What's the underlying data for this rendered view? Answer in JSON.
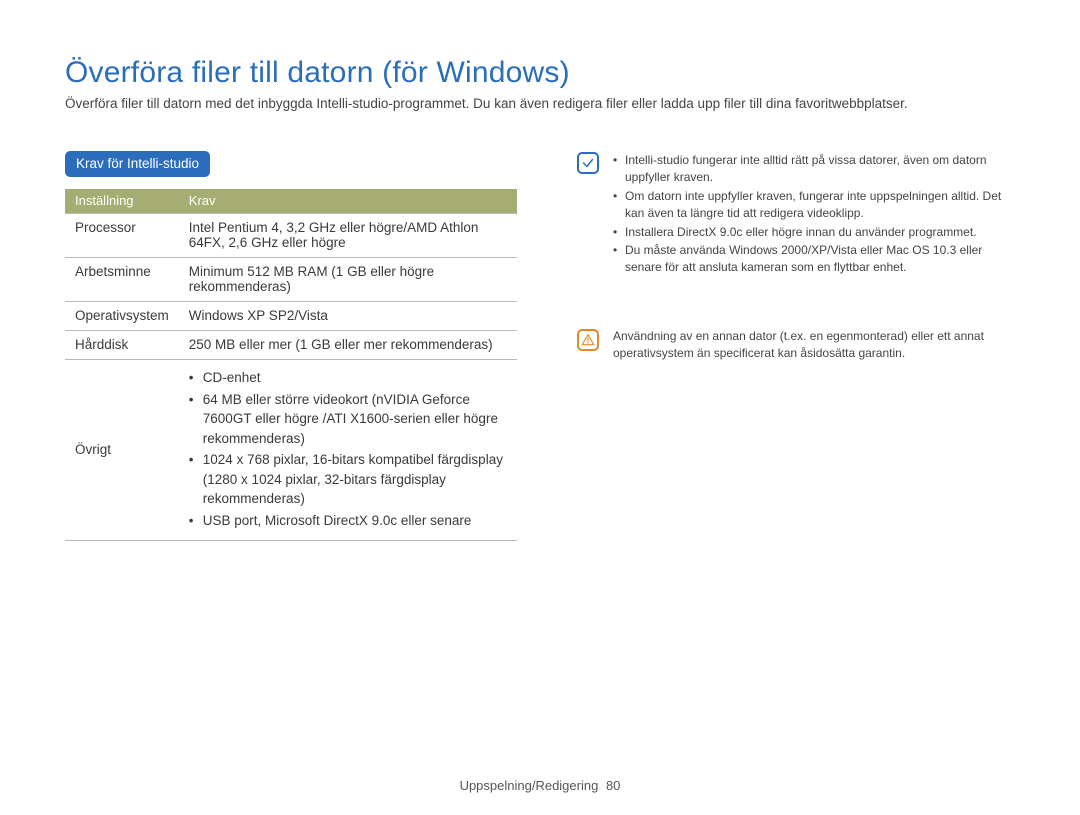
{
  "page": {
    "title": "Överföra filer till datorn (för Windows)",
    "intro": "Överföra filer till datorn med det inbyggda Intelli-studio-programmet. Du kan även redigera filer eller ladda upp filer till dina favoritwebbplatser.",
    "section_label": "Krav för Intelli-studio",
    "table": {
      "head_setting": "Inställning",
      "head_req": "Krav",
      "rows": {
        "processor": {
          "label": "Processor",
          "value": "Intel Pentium 4, 3,2 GHz eller högre/AMD Athlon 64FX, 2,6 GHz eller högre"
        },
        "ram": {
          "label": "Arbetsminne",
          "value": "Minimum 512 MB RAM (1 GB eller högre rekommenderas)"
        },
        "os": {
          "label": "Operativsystem",
          "value": "Windows XP SP2/Vista"
        },
        "hdd": {
          "label": "Hårddisk",
          "value": "250 MB eller mer (1 GB eller mer rekommenderas)"
        },
        "other": {
          "label": "Övrigt",
          "items": [
            "CD-enhet",
            "64 MB eller större videokort (nVIDIA Geforce 7600GT eller högre /ATI X1600-serien eller högre rekommenderas)",
            "1024 x 768 pixlar, 16-bitars kompatibel färgdisplay (1280 x 1024 pixlar, 32-bitars färgdisplay rekommenderas)",
            "USB port, Microsoft DirectX 9.0c eller senare"
          ]
        }
      }
    },
    "note_items": [
      "Intelli-studio fungerar inte alltid rätt på vissa datorer, även om datorn uppfyller kraven.",
      "Om datorn inte uppfyller kraven, fungerar inte uppspelningen alltid. Det kan även ta längre tid att redigera videoklipp.",
      "Installera DirectX 9.0c eller högre innan du använder programmet.",
      "Du måste använda Windows 2000/XP/Vista eller Mac OS 10.3 eller senare för att ansluta kameran som en flyttbar enhet."
    ],
    "warning_text": "Användning av en annan dator (t.ex. en egenmonterad) eller ett annat operativsystem än specificerat kan åsidosätta garantin.",
    "footer_label": "Uppspelning/Redigering",
    "footer_page": "80"
  }
}
